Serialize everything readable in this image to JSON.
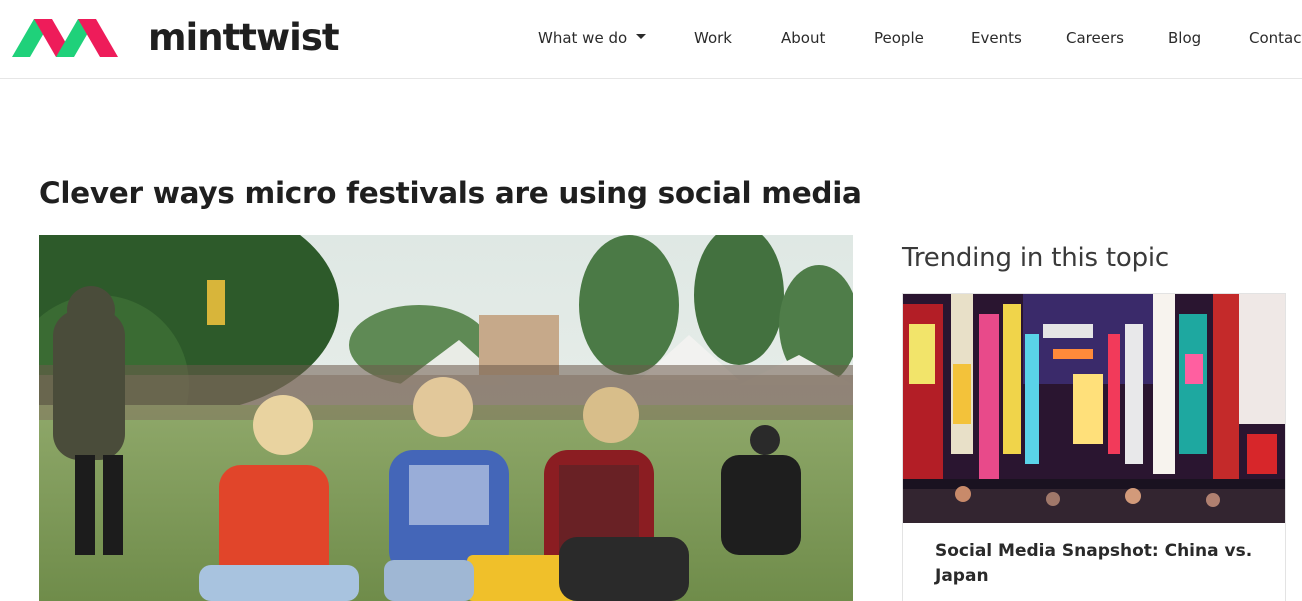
{
  "brand": {
    "name": "minttwist",
    "colors": {
      "green": "#1fd17a",
      "pink": "#ee1c5a"
    }
  },
  "nav": {
    "items": [
      {
        "label": "What we do",
        "has_dropdown": true
      },
      {
        "label": "Work"
      },
      {
        "label": "About"
      },
      {
        "label": "People"
      },
      {
        "label": "Events"
      },
      {
        "label": "Careers"
      },
      {
        "label": "Blog"
      },
      {
        "label": "Contact"
      }
    ]
  },
  "article": {
    "title": "Clever ways micro festivals are using social media",
    "hero_image": "festival-crowd-photo"
  },
  "sidebar": {
    "heading": "Trending in this topic",
    "cards": [
      {
        "image": "neon-street-signs-photo",
        "title": "Social Media Snapshot: China vs. Japan"
      }
    ]
  }
}
